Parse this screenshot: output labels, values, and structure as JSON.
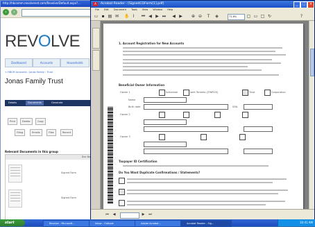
{
  "ie": {
    "title": "http://hbcomm.revolvenet.com/Revolve/Default.aspx?...",
    "logo_pre": "REV",
    "logo_o": "O",
    "logo_post": "LVE",
    "tabs": [
      "Dashboard",
      "Accounts",
      "Households"
    ],
    "breadcrumb": "< HBCM Accounts › Jonas Family › Trust",
    "page_title": "Jonas Family Trust",
    "dark_tabs": [
      "Details",
      "Documents",
      "Generate"
    ],
    "buttons": [
      "Print",
      "Delete",
      "Copy"
    ],
    "subtabs": [
      "Filing",
      "Emails",
      "Files",
      "Recent"
    ],
    "folder_heading": "Relevant Documents in this group",
    "table_header": "Doc Name",
    "doc_names": [
      "Signed Form",
      "Signed Form"
    ]
  },
  "reader": {
    "title": "Acrobat Reader - [SignedCOForm[1].pdf]",
    "icon": "A",
    "menu": [
      "File",
      "Edit",
      "Document",
      "Tools",
      "View",
      "Window",
      "Help"
    ],
    "zoom": "71.6%",
    "doc": {
      "section1": "1. Account Registration for New Accounts",
      "section2": "Beneficial Owner Information",
      "owner_labels": [
        "Owner 1",
        "Owner 2",
        "Owner 3"
      ],
      "owner_options": [
        "Individual",
        "Joint Tenants (JTWROS)",
        "Trust",
        "Corporation"
      ],
      "field_labels": [
        "Name",
        "Birth date",
        "SSN"
      ],
      "section3": "Taxpayer ID Certification",
      "section4": "Do You Want Duplicate Confirmations / Statements?"
    }
  },
  "taskbar": {
    "start": "start",
    "tasks": [
      "Revolve - Microsoft...",
      "Inbox - Outlook",
      "Adobe Acrobat...",
      "Acrobat Reader - Sig..."
    ],
    "clock": "10:41 AM"
  }
}
